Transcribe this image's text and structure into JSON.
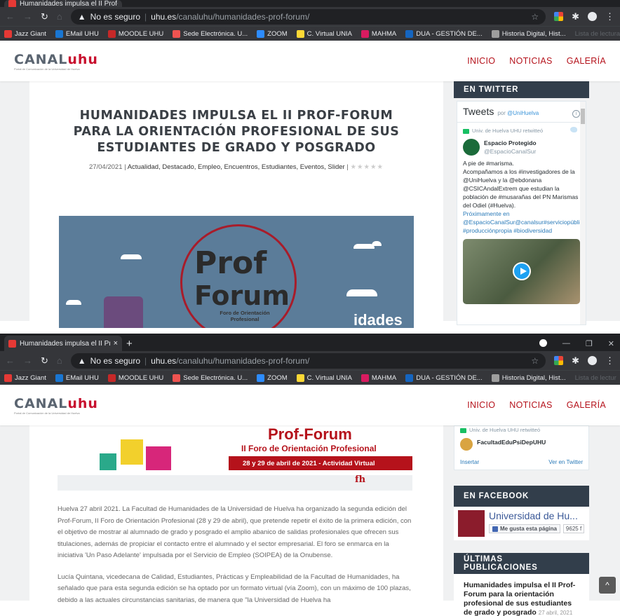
{
  "browser": {
    "tab_title": "Humanidades impulsa el II Prof-F",
    "tab_title_full": "Humanidades impulsa el II Prof-",
    "not_secure": "No es seguro",
    "separator": "|",
    "host": "uhu.es",
    "path": "/canaluhu/humanidades-prof-forum/",
    "bookmarks": [
      {
        "label": "Jazz Giant",
        "color": "#e53935"
      },
      {
        "label": "EMail UHU",
        "color": "#1976d2"
      },
      {
        "label": "MOODLE UHU",
        "color": "#c62828"
      },
      {
        "label": "Sede Electrónica. U...",
        "color": "#ef5350"
      },
      {
        "label": "ZOOM",
        "color": "#2d8cff"
      },
      {
        "label": "C. Virtual UNIA",
        "color": "#fdd835"
      },
      {
        "label": "MAHMA",
        "color": "#d81b60"
      },
      {
        "label": "DUA - GESTIÓN DE...",
        "color": "#1565c0"
      },
      {
        "label": "Historia Digital, Hist...",
        "color": "#9e9e9e"
      }
    ],
    "reading_list": "Lista de lectura",
    "reading_list_short": "Lista de lectur"
  },
  "site": {
    "logo_canal": "CANAL",
    "logo_uhu": "uhu",
    "logo_tagline": "Portal de Comunicación de la Universidad de Huelva",
    "nav": [
      "INICIO",
      "NOTICIAS",
      "GALERÍA"
    ]
  },
  "article": {
    "title": "HUMANIDADES IMPULSA EL II PROF-FORUM PARA LA ORIENTACIÓN PROFESIONAL DE SUS ESTUDIANTES DE GRADO Y POSGRADO",
    "date": "27/04/2021",
    "categories": "Actualidad, Destacado, Empleo, Encuentros, Estudiantes, Eventos, Slider",
    "sep": "|",
    "rating": "★★★★★",
    "hero": {
      "prof": "Prof",
      "forum": "Forum",
      "subtitle": "Foro de Orientación Profesional",
      "cut_text": "idades"
    },
    "banner": {
      "title": "Prof-Forum",
      "line1": "II Foro de Orientación Profesional",
      "line2": "28 y 29 de abril de 2021 - Actividad Virtual",
      "fh": "fh"
    },
    "paragraphs": [
      "Huelva 27 abril 2021. La Facultad de Humanidades de la Universidad de Huelva ha organizado la segunda edición del Prof-Forum, II Foro de Orientación Profesional (28 y 29 de abril), que pretende repetir el éxito de la primera edición, con el objetivo de mostrar al alumnado de grado y posgrado el amplio abanico de salidas profesionales que ofrecen sus titulaciones, además de propiciar el contacto entre el alumnado y el sector empresarial. El foro se enmarca en la iniciativa 'Un Paso Adelante' impulsada por el Servicio de Empleo (SOIPEA) de la Onubense.",
      "Lucía Quintana, vicedecana de Calidad, Estudiantes, Prácticas y Empleabilidad de la Facultad de Humanidades, ha señalado que para esta segunda edición se ha optado por un formato virtual (vía Zoom), con un máximo de 100 plazas, debido a las actuales circunstancias sanitarias, de manera que \"la Universidad de Huelva ha"
    ]
  },
  "twitter": {
    "widget_title": "EN TWITTER",
    "header": "Tweets",
    "by": "por",
    "handle": "@UniHuelva",
    "info": "i",
    "tweet": {
      "retweet": "Univ. de Huelva UHU retwitteó",
      "author": "Espacio Protegido",
      "author_handle": "@EspacioCanalSur",
      "text_lines": [
        "A pie de #marisma.",
        "Acompañamos a los #investigadores de la @UniHuelva y la @ebdonana @CSICAndalExtrem que estudian la población de #musarañas del PN Marismas del Odiel (#Huelva).",
        "Próximamente en @EspacioCanalSur@canalsur#serviciopúblico #producciónpropia #biodiversidad"
      ]
    },
    "tweet2": {
      "retweet": "Univ. de Huelva UHU retwitteó",
      "author": "FacultadEduPsiDepUHU"
    },
    "embed": "Insertar",
    "view_on": "Ver en Twitter"
  },
  "facebook": {
    "widget_title": "EN FACEBOOK",
    "page_name": "Universidad de Hu...",
    "like": "Me gusta esta página",
    "count": "9625 f"
  },
  "recent": {
    "widget_title": "ÚLTIMAS PUBLICACIONES",
    "item_title": "Humanidades impulsa el II Prof-Forum para la orientación profesional de sus estudiantes de grado y posgrado",
    "item_date": "27 abril, 2021"
  },
  "icons": {
    "to_top": "^"
  }
}
